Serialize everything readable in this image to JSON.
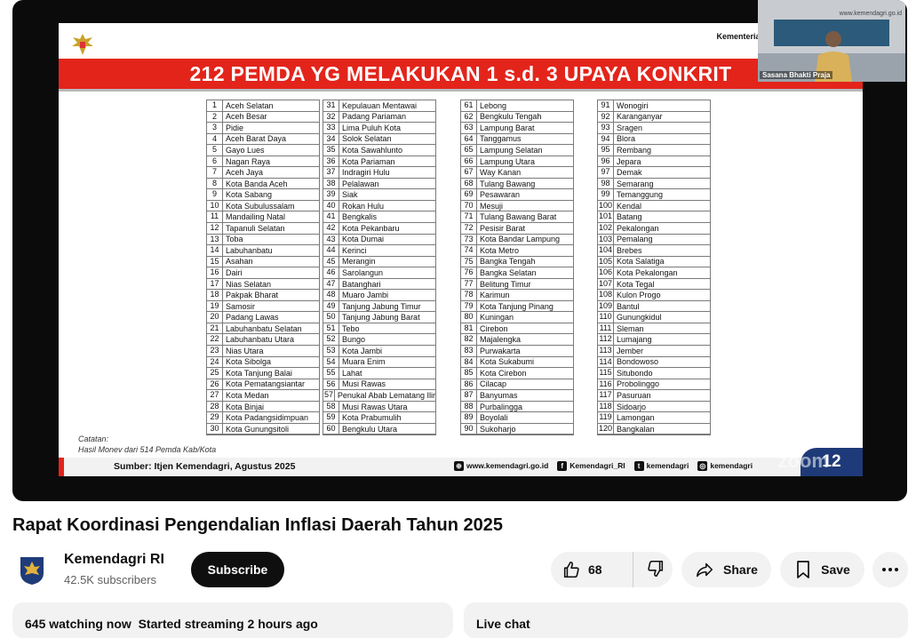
{
  "slide": {
    "org": "Kementerian",
    "banner": "212 PEMDA YG MELAKUKAN 1 s.d. 3 UPAYA KONKRIT",
    "note_label": "Catatan:",
    "note_text": "Hasil Monev dari 514 Pemda Kab/Kota",
    "source": "Sumber: Itjen Kemendagri, Agustus 2025",
    "website": "www.kemendagri.go.id",
    "facebook": "Kemendagri_RI",
    "twitter": "kemendagri",
    "instagram": "kemendagri",
    "page_number": "12",
    "watermark": "zoom",
    "columns": [
      [
        {
          "n": "1",
          "name": "Aceh Selatan"
        },
        {
          "n": "2",
          "name": "Aceh Besar"
        },
        {
          "n": "3",
          "name": "Pidie"
        },
        {
          "n": "4",
          "name": "Aceh Barat Daya"
        },
        {
          "n": "5",
          "name": "Gayo Lues"
        },
        {
          "n": "6",
          "name": "Nagan Raya"
        },
        {
          "n": "7",
          "name": "Aceh Jaya"
        },
        {
          "n": "8",
          "name": "Kota Banda Aceh"
        },
        {
          "n": "9",
          "name": "Kota Sabang"
        },
        {
          "n": "10",
          "name": "Kota Subulussalam"
        },
        {
          "n": "11",
          "name": "Mandailing Natal"
        },
        {
          "n": "12",
          "name": "Tapanuli Selatan"
        },
        {
          "n": "13",
          "name": "Toba"
        },
        {
          "n": "14",
          "name": "Labuhanbatu"
        },
        {
          "n": "15",
          "name": "Asahan"
        },
        {
          "n": "16",
          "name": "Dairi"
        },
        {
          "n": "17",
          "name": "Nias Selatan"
        },
        {
          "n": "18",
          "name": "Pakpak Bharat"
        },
        {
          "n": "19",
          "name": "Samosir"
        },
        {
          "n": "20",
          "name": "Padang Lawas"
        },
        {
          "n": "21",
          "name": "Labuhanbatu Selatan"
        },
        {
          "n": "22",
          "name": "Labuhanbatu Utara"
        },
        {
          "n": "23",
          "name": "Nias Utara"
        },
        {
          "n": "24",
          "name": "Kota Sibolga"
        },
        {
          "n": "25",
          "name": "Kota Tanjung Balai"
        },
        {
          "n": "26",
          "name": "Kota Pematangsiantar"
        },
        {
          "n": "27",
          "name": "Kota Medan"
        },
        {
          "n": "28",
          "name": "Kota Binjai"
        },
        {
          "n": "29",
          "name": "Kota Padangsidimpuan"
        },
        {
          "n": "30",
          "name": "Kota Gunungsitoli"
        }
      ],
      [
        {
          "n": "31",
          "name": "Kepulauan Mentawai"
        },
        {
          "n": "32",
          "name": "Padang Pariaman"
        },
        {
          "n": "33",
          "name": "Lima Puluh Kota"
        },
        {
          "n": "34",
          "name": "Solok Selatan"
        },
        {
          "n": "35",
          "name": "Kota Sawahlunto"
        },
        {
          "n": "36",
          "name": "Kota Pariaman"
        },
        {
          "n": "37",
          "name": "Indragiri Hulu"
        },
        {
          "n": "38",
          "name": "Pelalawan"
        },
        {
          "n": "39",
          "name": "Siak"
        },
        {
          "n": "40",
          "name": "Rokan Hulu"
        },
        {
          "n": "41",
          "name": "Bengkalis"
        },
        {
          "n": "42",
          "name": "Kota Pekanbaru"
        },
        {
          "n": "43",
          "name": "Kota Dumai"
        },
        {
          "n": "44",
          "name": "Kerinci"
        },
        {
          "n": "45",
          "name": "Merangin"
        },
        {
          "n": "46",
          "name": "Sarolangun"
        },
        {
          "n": "47",
          "name": "Batanghari"
        },
        {
          "n": "48",
          "name": "Muaro Jambi"
        },
        {
          "n": "49",
          "name": "Tanjung Jabung Timur"
        },
        {
          "n": "50",
          "name": "Tanjung Jabung Barat"
        },
        {
          "n": "51",
          "name": "Tebo"
        },
        {
          "n": "52",
          "name": "Bungo"
        },
        {
          "n": "53",
          "name": "Kota Jambi"
        },
        {
          "n": "54",
          "name": "Muara Enim"
        },
        {
          "n": "55",
          "name": "Lahat"
        },
        {
          "n": "56",
          "name": "Musi Rawas"
        },
        {
          "n": "57",
          "name": "Penukal Abab Lematang Ilir"
        },
        {
          "n": "58",
          "name": "Musi Rawas Utara"
        },
        {
          "n": "59",
          "name": "Kota Prabumulih"
        },
        {
          "n": "60",
          "name": "Bengkulu Utara"
        }
      ],
      [
        {
          "n": "61",
          "name": "Lebong"
        },
        {
          "n": "62",
          "name": "Bengkulu Tengah"
        },
        {
          "n": "63",
          "name": "Lampung Barat"
        },
        {
          "n": "64",
          "name": "Tanggamus"
        },
        {
          "n": "65",
          "name": "Lampung Selatan"
        },
        {
          "n": "66",
          "name": "Lampung Utara"
        },
        {
          "n": "67",
          "name": "Way Kanan"
        },
        {
          "n": "68",
          "name": "Tulang Bawang"
        },
        {
          "n": "69",
          "name": "Pesawaran"
        },
        {
          "n": "70",
          "name": "Mesuji"
        },
        {
          "n": "71",
          "name": "Tulang Bawang Barat"
        },
        {
          "n": "72",
          "name": "Pesisir Barat"
        },
        {
          "n": "73",
          "name": "Kota Bandar Lampung"
        },
        {
          "n": "74",
          "name": "Kota Metro"
        },
        {
          "n": "75",
          "name": "Bangka Tengah"
        },
        {
          "n": "76",
          "name": "Bangka Selatan"
        },
        {
          "n": "77",
          "name": "Belitung Timur"
        },
        {
          "n": "78",
          "name": "Karimun"
        },
        {
          "n": "79",
          "name": "Kota Tanjung Pinang"
        },
        {
          "n": "80",
          "name": "Kuningan"
        },
        {
          "n": "81",
          "name": "Cirebon"
        },
        {
          "n": "82",
          "name": "Majalengka"
        },
        {
          "n": "83",
          "name": "Purwakarta"
        },
        {
          "n": "84",
          "name": "Kota Sukabumi"
        },
        {
          "n": "85",
          "name": "Kota Cirebon"
        },
        {
          "n": "86",
          "name": "Cilacap"
        },
        {
          "n": "87",
          "name": "Banyumas"
        },
        {
          "n": "88",
          "name": "Purbalingga"
        },
        {
          "n": "89",
          "name": "Boyolali"
        },
        {
          "n": "90",
          "name": "Sukoharjo"
        }
      ],
      [
        {
          "n": "91",
          "name": "Wonogiri"
        },
        {
          "n": "92",
          "name": "Karanganyar"
        },
        {
          "n": "93",
          "name": "Sragen"
        },
        {
          "n": "94",
          "name": "Blora"
        },
        {
          "n": "95",
          "name": "Rembang"
        },
        {
          "n": "96",
          "name": "Jepara"
        },
        {
          "n": "97",
          "name": "Demak"
        },
        {
          "n": "98",
          "name": "Semarang"
        },
        {
          "n": "99",
          "name": "Temanggung"
        },
        {
          "n": "100",
          "name": "Kendal"
        },
        {
          "n": "101",
          "name": "Batang"
        },
        {
          "n": "102",
          "name": "Pekalongan"
        },
        {
          "n": "103",
          "name": "Pemalang"
        },
        {
          "n": "104",
          "name": "Brebes"
        },
        {
          "n": "105",
          "name": "Kota Salatiga"
        },
        {
          "n": "106",
          "name": "Kota Pekalongan"
        },
        {
          "n": "107",
          "name": "Kota Tegal"
        },
        {
          "n": "108",
          "name": "Kulon Progo"
        },
        {
          "n": "109",
          "name": "Bantul"
        },
        {
          "n": "110",
          "name": "Gunungkidul"
        },
        {
          "n": "111",
          "name": "Sleman"
        },
        {
          "n": "112",
          "name": "Lumajang"
        },
        {
          "n": "113",
          "name": "Jember"
        },
        {
          "n": "114",
          "name": "Bondowoso"
        },
        {
          "n": "115",
          "name": "Situbondo"
        },
        {
          "n": "116",
          "name": "Probolinggo"
        },
        {
          "n": "117",
          "name": "Pasuruan"
        },
        {
          "n": "118",
          "name": "Sidoarjo"
        },
        {
          "n": "119",
          "name": "Lamongan"
        },
        {
          "n": "120",
          "name": "Bangkalan"
        }
      ]
    ]
  },
  "camera": {
    "caption": "Sasana Bhakti Praja",
    "url": "www.kemendagri.go.id"
  },
  "video": {
    "title": "Rapat Koordinasi Pengendalian Inflasi Daerah Tahun 2025",
    "channel": "Kemendagri RI",
    "subscribers": "42.5K subscribers",
    "subscribe_label": "Subscribe",
    "likes": "68",
    "share_label": "Share",
    "save_label": "Save",
    "watching": "645 watching now",
    "started": "Started streaming 2 hours ago",
    "live_chat": "Live chat"
  }
}
